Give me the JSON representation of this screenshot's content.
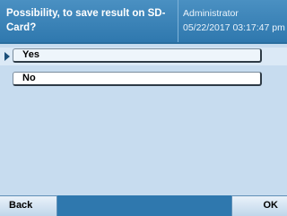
{
  "header": {
    "title": "Possibility, to save result on SD-Card?",
    "user": "Administrator",
    "datetime": "05/22/2017 03:17:47 pm"
  },
  "options": [
    {
      "label": "Yes",
      "selected": true
    },
    {
      "label": "No",
      "selected": false
    }
  ],
  "footer": {
    "back_label": "Back",
    "ok_label": "OK"
  },
  "colors": {
    "header_bg": "#2f78ae",
    "body_bg": "#c7dcef",
    "selection_bg": "#dbe9f6"
  }
}
